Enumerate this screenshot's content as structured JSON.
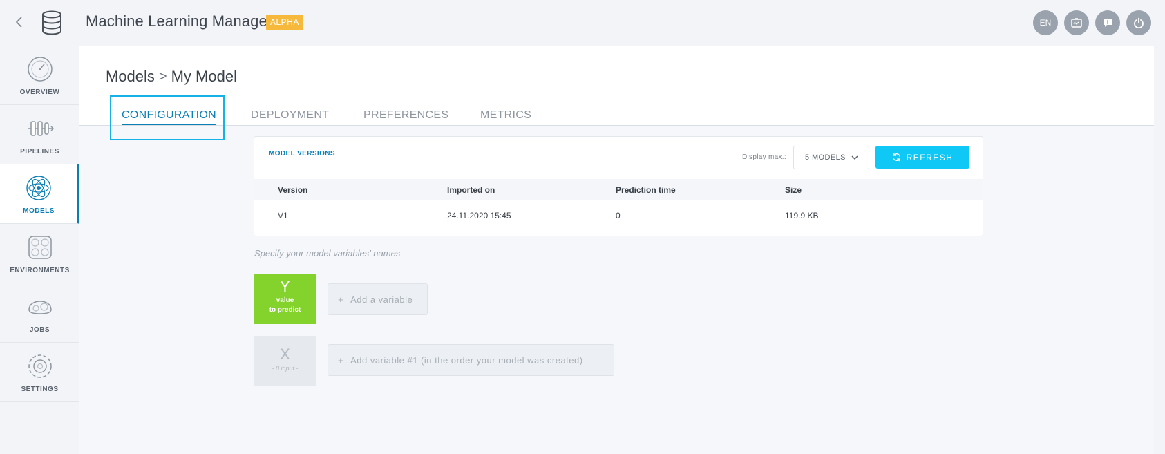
{
  "header": {
    "title": "Machine Learning Manager",
    "badge": "ALPHA",
    "actions": {
      "language": "EN"
    }
  },
  "sidebar": {
    "items": [
      {
        "label": "OVERVIEW",
        "icon": "gauge-icon"
      },
      {
        "label": "PIPELINES",
        "icon": "pipeline-icon"
      },
      {
        "label": "MODELS",
        "icon": "atom-icon",
        "active": true
      },
      {
        "label": "ENVIRONMENTS",
        "icon": "environment-icon"
      },
      {
        "label": "JOBS",
        "icon": "gears-icon"
      },
      {
        "label": "SETTINGS",
        "icon": "settings-icon"
      }
    ]
  },
  "breadcrumb": {
    "root": "Models",
    "separator": ">",
    "current": "My Model"
  },
  "tabs": [
    {
      "label": "CONFIGURATION",
      "active": true
    },
    {
      "label": "DEPLOYMENT"
    },
    {
      "label": "PREFERENCES"
    },
    {
      "label": "METRICS"
    }
  ],
  "versions": {
    "title": "MODEL VERSIONS",
    "display_label": "Display max.:",
    "display_value": "5 MODELS",
    "refresh_label": "REFRESH",
    "columns": [
      "Version",
      "Imported on",
      "Prediction time",
      "Size"
    ],
    "rows": [
      [
        "V1",
        "24.11.2020 15:45",
        "0",
        "119.9 KB"
      ]
    ]
  },
  "variables": {
    "hint": "Specify your model variables' names",
    "y": {
      "letter": "Y",
      "line1": "value",
      "line2": "to predict",
      "add_label": "Add a variable"
    },
    "x": {
      "letter": "X",
      "sub": "- 0 input -",
      "add_label": "Add variable #1 (in the order your model was created)"
    }
  },
  "colors": {
    "accent": "#0b7fb5",
    "refresh": "#10c8f5",
    "y_box": "#84d32c",
    "alpha_badge": "#f6b93b"
  }
}
